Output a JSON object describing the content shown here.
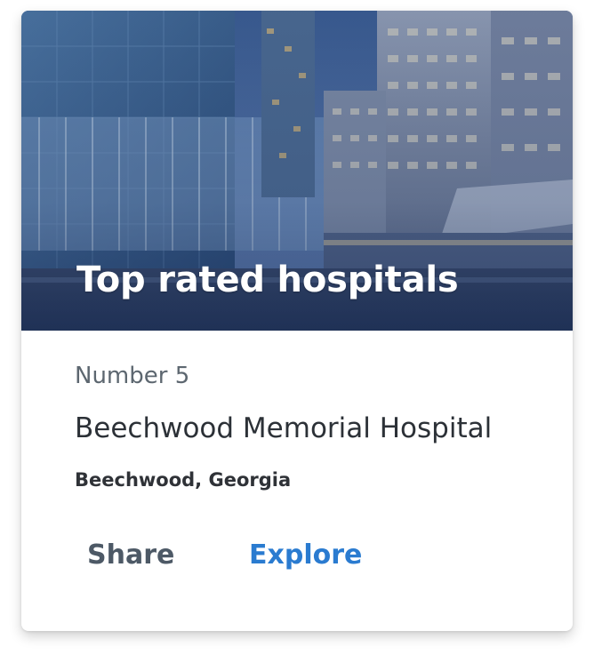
{
  "hero": {
    "title": "Top rated hospitals",
    "image": "hospital-buildings-at-dusk-photo"
  },
  "card": {
    "rank_label": "Number 5",
    "hospital_name": "Beechwood Memorial Hospital",
    "location": "Beechwood, Georgia"
  },
  "actions": {
    "share_label": "Share",
    "explore_label": "Explore"
  },
  "colors": {
    "accent": "#2a7bd0",
    "secondary_text": "#5d6770",
    "primary_text": "#2c3137",
    "hero_overlay": "#2e4a7a"
  }
}
